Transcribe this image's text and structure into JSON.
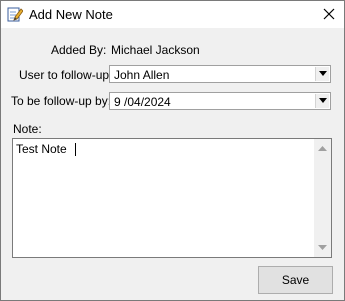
{
  "window": {
    "title": "Add New Note",
    "icon": "edit-note-icon"
  },
  "form": {
    "added_by": {
      "label": "Added By:",
      "value": "Michael Jackson"
    },
    "user_to_follow_up": {
      "label": "User to follow-up:",
      "value": "John Allen"
    },
    "follow_up_by": {
      "label": "To be follow-up by:",
      "value": "9 /04/2024"
    },
    "note": {
      "label": "Note:",
      "value": "Test Note"
    }
  },
  "buttons": {
    "save_label": "Save"
  },
  "colors": {
    "window_bg": "#f0f0f0",
    "titlebar_bg": "#ffffff",
    "field_bg": "#ffffff",
    "border": "#7a7a7a"
  }
}
